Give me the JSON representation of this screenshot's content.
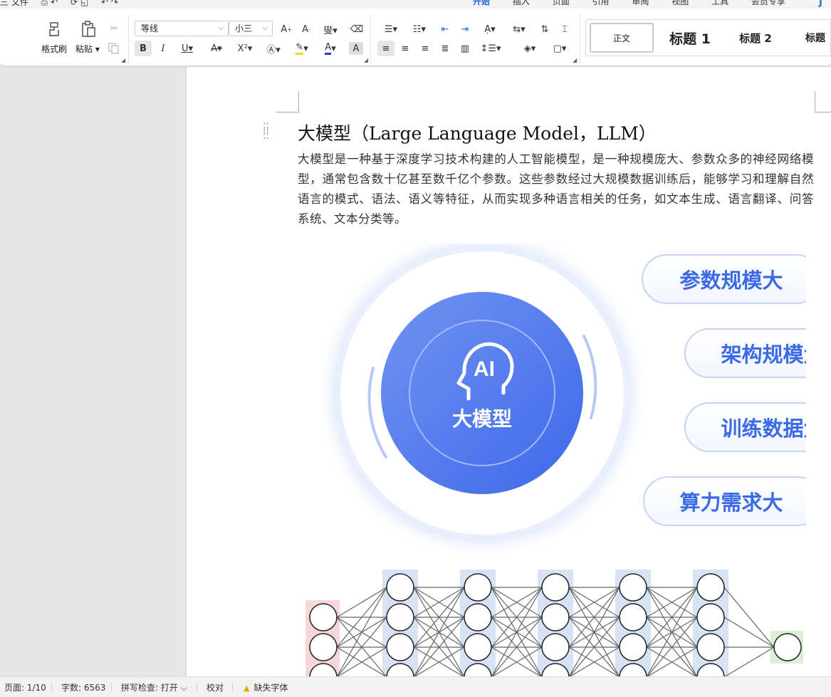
{
  "menubar": {
    "left_items": [
      "三 文件",
      "⎙ ↶",
      "⟳ ◱",
      "↶ ↷"
    ],
    "tabs": [
      "开始",
      "插入",
      "页面",
      "引用",
      "审阅",
      "视图",
      "工具",
      "会员专享"
    ],
    "active_tab": "开始",
    "corner": "J"
  },
  "ribbon": {
    "format_painter": "格式刷",
    "paste": "粘贴",
    "font_name": "等线",
    "font_size": "小三",
    "styles": [
      "正文",
      "标题 1",
      "标题 2",
      "标题"
    ]
  },
  "document": {
    "title": "大模型（Large Language Model，LLM）",
    "paragraph": "大模型是一种基于深度学习技术构建的人工智能模型，是一种规模庞大、参数众多的神经网络模型，通常包含数十亿甚至数千亿个参数。这些参数经过大规模数据训练后，能够学习和理解自然语言的模式、语法、语义等特征，从而实现多种语言相关的任务，如文本生成、语言翻译、问答系统、文本分类等。"
  },
  "infographic": {
    "center_icon": "AI",
    "center_label": "大模型",
    "pills": [
      "参数规模大",
      "架构规模大",
      "训练数据大",
      "算力需求大"
    ],
    "accent": "#4a78f0"
  },
  "neural_net": {
    "input_color": "#f6d6d8",
    "hidden_color": "#d7e2f5",
    "output_color": "#d9f0d2"
  },
  "statusbar": {
    "page": "页面: 1/10",
    "words": "字数: 6563",
    "spellcheck": "拼写检查: 打开",
    "proofread": "校对",
    "missing_font": "缺失字体"
  }
}
